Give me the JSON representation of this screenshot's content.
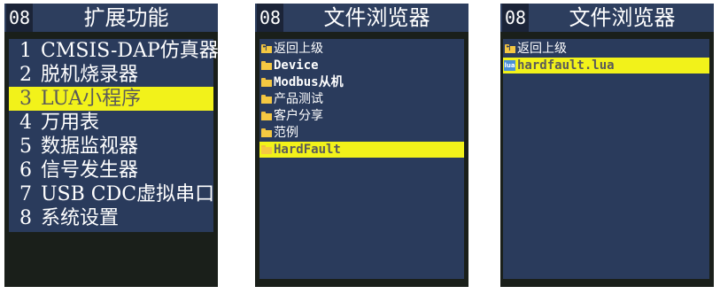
{
  "screen1": {
    "number": "08",
    "title": "扩展功能",
    "items": [
      {
        "n": "1",
        "label": "CMSIS-DAP仿真器"
      },
      {
        "n": "2",
        "label": "脱机烧录器"
      },
      {
        "n": "3",
        "label": "LUA小程序"
      },
      {
        "n": "4",
        "label": "万用表"
      },
      {
        "n": "5",
        "label": "数据监视器"
      },
      {
        "n": "6",
        "label": "信号发生器"
      },
      {
        "n": "7",
        "label": "USB CDC虚拟串口"
      },
      {
        "n": "8",
        "label": "系统设置"
      }
    ],
    "selected_index": 2
  },
  "screen2": {
    "number": "08",
    "title": "文件浏览器",
    "items": [
      {
        "label": "返回上级",
        "icon": "folder-up-icon"
      },
      {
        "label": "Device",
        "icon": "folder-icon"
      },
      {
        "label": "Modbus从机",
        "icon": "folder-icon"
      },
      {
        "label": "产品测试",
        "icon": "folder-icon"
      },
      {
        "label": "客户分享",
        "icon": "folder-icon"
      },
      {
        "label": "范例",
        "icon": "folder-icon"
      },
      {
        "label": "HardFault",
        "icon": "folder-icon"
      }
    ],
    "selected_index": 6
  },
  "screen3": {
    "number": "08",
    "title": "文件浏览器",
    "items": [
      {
        "label": "返回上级",
        "icon": "folder-up-icon"
      },
      {
        "label": "hardfault.lua",
        "icon": "lua-file-icon",
        "icon_text": "lua"
      }
    ],
    "selected_index": 1
  },
  "colors": {
    "header_bg": "#2d3e5e",
    "panel_bg": "#2a3b5c",
    "screen_bg": "#1a1f1a",
    "selection": "#f2f21a",
    "folder": "#f5c842"
  }
}
